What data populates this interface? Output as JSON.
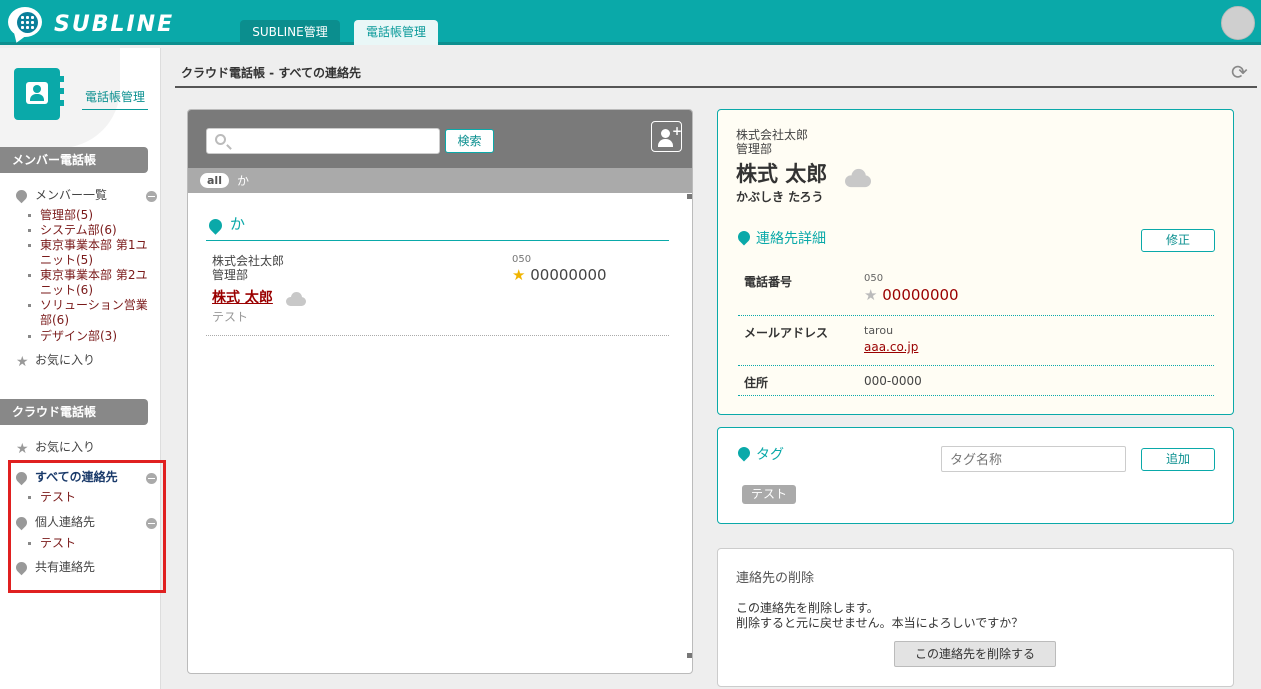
{
  "header": {
    "logo_text": "SUBLINE",
    "tabs": [
      {
        "label": "SUBLINE管理"
      },
      {
        "label": "電話帳管理"
      }
    ]
  },
  "sidebar": {
    "title": "電話帳管理",
    "member_section": {
      "heading": "メンバー電話帳",
      "list_label": "メンバー一覧",
      "departments": [
        "管理部(5)",
        "システム部(6)",
        "東京事業本部 第1ユニット(5)",
        "東京事業本部 第2ユニット(6)",
        "ソリューション営業部(6)",
        "デザイン部(3)"
      ],
      "favorites": "お気に入り"
    },
    "cloud_section": {
      "heading": "クラウド電話帳",
      "favorites": "お気に入り",
      "all_contacts": "すべての連絡先",
      "all_sub": "テスト",
      "personal": "個人連絡先",
      "personal_sub": "テスト",
      "shared": "共有連絡先"
    }
  },
  "breadcrumb": "クラウド電話帳 - すべての連絡先",
  "list": {
    "search_placeholder": "",
    "search_button": "検索",
    "alpha_all": "all",
    "alpha_ka": "か",
    "group_label": "か",
    "contact": {
      "company": "株式会社太郎",
      "department": "管理部",
      "name": "株式 太郎",
      "tag": "テスト",
      "phone_prefix": "050",
      "phone": "00000000"
    }
  },
  "detail": {
    "company": "株式会社太郎",
    "department": "管理部",
    "name": "株式 太郎",
    "kana": "かぶしき たろう",
    "section_title": "連絡先詳細",
    "edit_button": "修正",
    "phone_label": "電話番号",
    "phone_prefix": "050",
    "phone": "00000000",
    "email_label": "メールアドレス",
    "email_user": "tarou",
    "email_domain": "aaa.co.jp",
    "address_label": "住所",
    "address": "000-0000"
  },
  "tags": {
    "title": "タグ",
    "input_placeholder": "タグ名称",
    "add_button": "追加",
    "chip": "テスト"
  },
  "delete": {
    "title": "連絡先の削除",
    "line1": "この連絡先を削除します。",
    "line2": "削除すると元に戻せません。本当によろしいですか？",
    "button": "この連絡先を削除する"
  }
}
